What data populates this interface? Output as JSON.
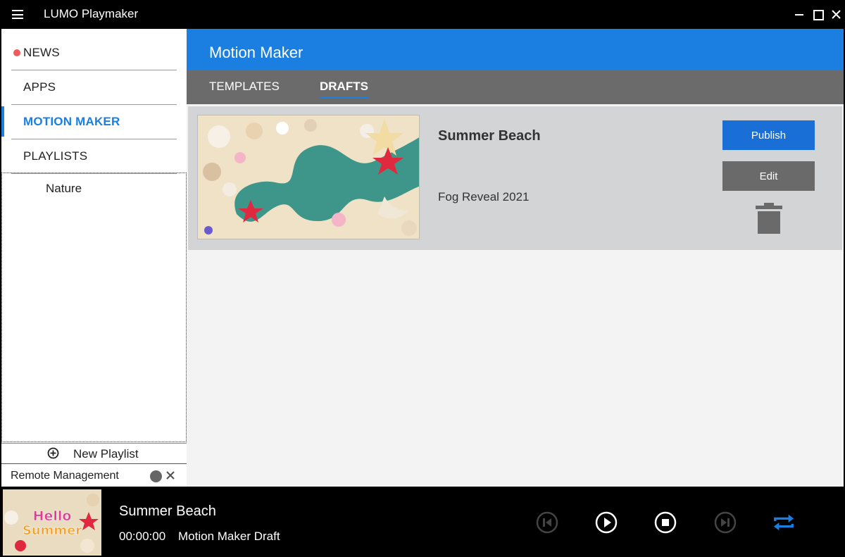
{
  "app": {
    "title": "LUMO Playmaker"
  },
  "sidebar": {
    "items": [
      {
        "label": "NEWS",
        "has_dot": true
      },
      {
        "label": "APPS"
      },
      {
        "label": "MOTION MAKER",
        "active": true
      },
      {
        "label": "PLAYLISTS"
      }
    ],
    "playlists": [
      "Nature"
    ],
    "new_playlist_label": "New Playlist",
    "remote_label": "Remote Management"
  },
  "main": {
    "title": "Motion Maker",
    "tabs": [
      {
        "label": "TEMPLATES"
      },
      {
        "label": "DRAFTS",
        "active": true
      }
    ],
    "drafts": [
      {
        "title": "Summer Beach",
        "subtitle": "Fog Reveal 2021",
        "publish_label": "Publish",
        "edit_label": "Edit"
      }
    ]
  },
  "player": {
    "title": "Summer Beach",
    "time": "00:00:00",
    "type": "Motion Maker Draft",
    "thumb_text": [
      "Hello",
      "Summer"
    ]
  },
  "colors": {
    "accent": "#1a7fe0",
    "publish": "#1a6fd6",
    "news_dot": "#ef5b5b",
    "tab_bar": "#6b6b6b",
    "card": "#d3d4d5"
  }
}
